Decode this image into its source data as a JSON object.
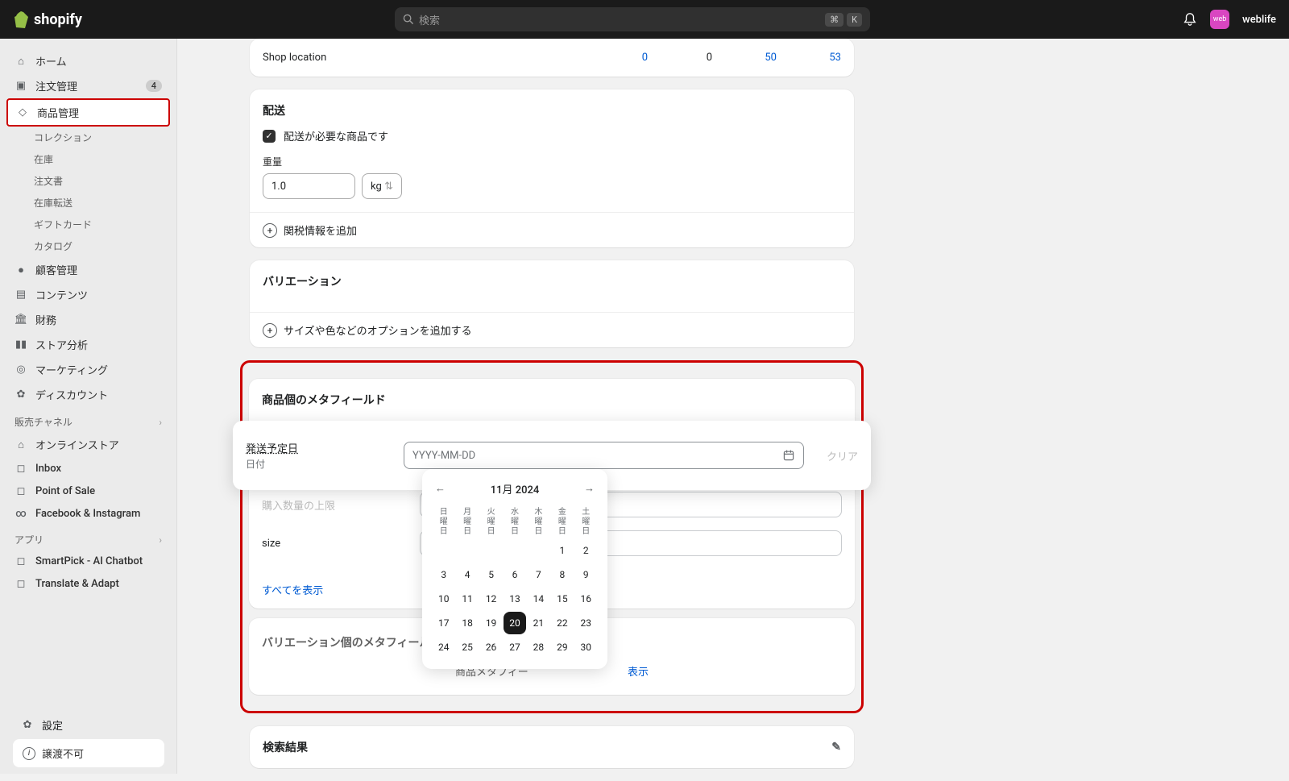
{
  "header": {
    "search_ph": "検索",
    "kbd1": "⌘",
    "kbd2": "K",
    "avatar": "web",
    "user": "weblife"
  },
  "sidebar": {
    "home": "ホーム",
    "orders": "注文管理",
    "orders_badge": "4",
    "products": "商品管理",
    "subs": [
      "コレクション",
      "在庫",
      "注文書",
      "在庫転送",
      "ギフトカード",
      "カタログ"
    ],
    "customers": "顧客管理",
    "content": "コンテンツ",
    "finance": "財務",
    "analytics": "ストア分析",
    "marketing": "マーケティング",
    "discounts": "ディスカウント",
    "channels_h": "販売チャネル",
    "online": "オンラインストア",
    "inbox": "Inbox",
    "pos": "Point of Sale",
    "fb": "Facebook & Instagram",
    "apps_h": "アプリ",
    "app1": "SmartPick - AI Chatbot",
    "app2": "Translate & Adapt",
    "settings": "設定",
    "transfer": "譲渡不可"
  },
  "inventory": {
    "loc": "Shop location",
    "v0": "0",
    "v1": "0",
    "v2": "50",
    "v3": "53"
  },
  "shipping": {
    "title": "配送",
    "req": "配送が必要な商品です",
    "weight_l": "重量",
    "weight_v": "1.0",
    "unit": "kg",
    "customs": "関税情報を追加"
  },
  "variation": {
    "title": "バリエーション",
    "add": "サイズや色などのオプションを追加する"
  },
  "metafields": {
    "title": "商品個のメタフィールド",
    "ship_date": "発送予定日",
    "ship_date_sub": "日付",
    "placeholder": "YYYY-MM-DD",
    "clear": "クリア",
    "row2": "購入数量の上限",
    "row3": "size",
    "showall": "すべてを表示"
  },
  "calendar": {
    "title": "11月 2024",
    "dow": [
      "日曜日",
      "月曜日",
      "火曜日",
      "水曜日",
      "木曜日",
      "金曜日",
      "土曜日"
    ],
    "weeks": [
      [
        "",
        "",
        "",
        "",
        "",
        "1",
        "2"
      ],
      [
        "3",
        "4",
        "5",
        "6",
        "7",
        "8",
        "9"
      ],
      [
        "10",
        "11",
        "12",
        "13",
        "14",
        "15",
        "16"
      ],
      [
        "17",
        "18",
        "19",
        "20",
        "21",
        "22",
        "23"
      ],
      [
        "24",
        "25",
        "26",
        "27",
        "28",
        "29",
        "30"
      ]
    ],
    "today": "20"
  },
  "var_meta": {
    "title": "バリエーション個のメタフィール",
    "text_pre": "商品メタフィー",
    "text_post": "表示"
  },
  "results": {
    "title": "検索結果"
  }
}
